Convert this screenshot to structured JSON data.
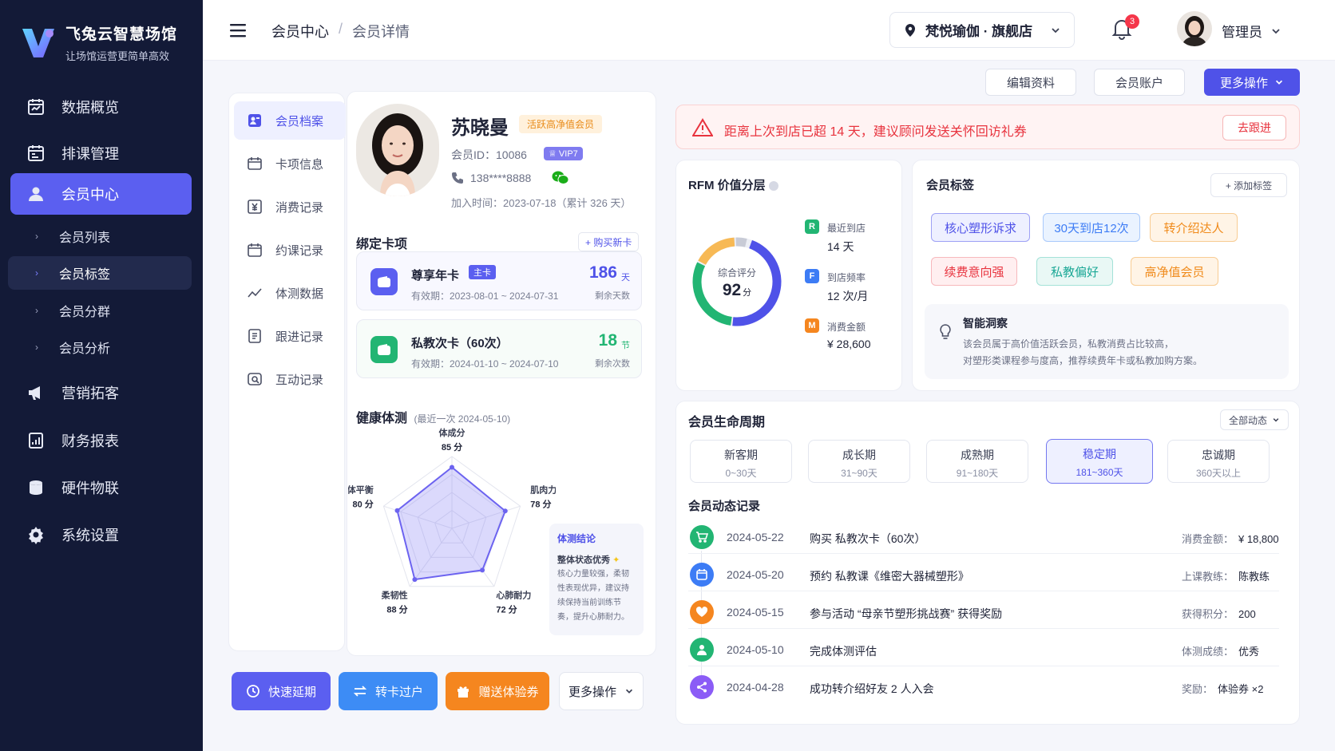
{
  "brand": {
    "name": "飞兔云智慧场馆",
    "slogan": "让场馆运营更简单高效"
  },
  "nav": [
    {
      "label": "数据概览",
      "icon": "dashboard-icon"
    },
    {
      "label": "排课管理",
      "icon": "calendar-icon"
    },
    {
      "label": "会员中心",
      "icon": "user-icon"
    },
    {
      "label": "营销拓客",
      "icon": "megaphone-icon"
    },
    {
      "label": "财务报表",
      "icon": "finance-icon"
    },
    {
      "label": "硬件物联",
      "icon": "hardware-icon"
    },
    {
      "label": "系统设置",
      "icon": "gear-icon"
    }
  ],
  "subnav": [
    {
      "label": "会员列表"
    },
    {
      "label": "会员标签"
    },
    {
      "label": "会员分群"
    },
    {
      "label": "会员分析"
    }
  ],
  "header": {
    "crumb1": "会员中心",
    "sep": "/",
    "crumb2": "会员详情",
    "store": "梵悦瑜伽 · 旗舰店",
    "bell_count": "3",
    "user": "管理员"
  },
  "toolbar": {
    "edit": "编辑资料",
    "account": "会员账户",
    "more": "更多操作"
  },
  "tabs": [
    {
      "label": "会员档案"
    },
    {
      "label": "卡项信息"
    },
    {
      "label": "消费记录"
    },
    {
      "label": "约课记录"
    },
    {
      "label": "体测数据"
    },
    {
      "label": "跟进记录"
    },
    {
      "label": "互动记录"
    }
  ],
  "member": {
    "name": "苏晓曼",
    "tag": "活跃高净值会员",
    "id": "会员ID：10086",
    "vip": "VIP7",
    "phone": "138****8888",
    "joined": "加入时间：2023-07-18（累计 326 天）"
  },
  "cards": {
    "title": "绑定卡项",
    "buy": "+ 购买新卡",
    "items": [
      {
        "name": "尊享年卡",
        "tag": "主卡",
        "valid": "有效期：2023-08-01 ~ 2024-07-31",
        "value": "186",
        "unit": "天",
        "label": "剩余天数",
        "color": "#4f52e8"
      },
      {
        "name": "私教次卡（60次）",
        "tag": "",
        "valid": "有效期：2024-01-10 ~ 2024-07-10",
        "value": "18",
        "unit": "节",
        "label": "剩余次数",
        "color": "#22b573"
      }
    ]
  },
  "health": {
    "title": "健康体测",
    "sub": "(最近一次 2024-05-10)",
    "radar": [
      {
        "name": "体成分",
        "score": "85",
        "unit": "分",
        "value": 85
      },
      {
        "name": "肌肉力量",
        "score": "78",
        "unit": "分",
        "value": 78
      },
      {
        "name": "心肺耐力",
        "score": "72",
        "unit": "分",
        "value": 72
      },
      {
        "name": "柔韧性",
        "score": "88",
        "unit": "分",
        "value": 88
      },
      {
        "name": "身体平衡",
        "score": "80",
        "unit": "分",
        "value": 80
      }
    ],
    "conclusion": {
      "title": "体测结论",
      "summary": "整体状态优秀",
      "body": "核心力量较强，柔韧性表现优异，建议持续保持当前训练节奏，提升心肺耐力。"
    }
  },
  "actions": {
    "extend": "快速延期",
    "transfer": "转卡过户",
    "gift": "赠送体验券",
    "more": "更多操作"
  },
  "alert": {
    "text": "距离上次到店已超 14 天，建议顾问发送关怀回访礼券",
    "action": "去跟进"
  },
  "rfm": {
    "title": "RFM 价值分层",
    "score_label": "综合评分",
    "score": "92",
    "score_unit": "分",
    "score_value": 92,
    "items": [
      {
        "key": "R",
        "label": "最近到店",
        "value": "14 天",
        "color": "#22b573"
      },
      {
        "key": "F",
        "label": "到店频率",
        "value": "12 次/月",
        "color": "#3d7cf5"
      },
      {
        "key": "M",
        "label": "消费金额",
        "value": "¥ 28,600",
        "color": "#f5861f"
      }
    ]
  },
  "tags": {
    "title": "会员标签",
    "add": "+ 添加标签",
    "items": [
      {
        "label": "核心塑形诉求",
        "bg": "#eef0ff",
        "fg": "#4f52e8",
        "bd": "#9ea1f5"
      },
      {
        "label": "30天到店12次",
        "bg": "#eaf3ff",
        "fg": "#3d7cf5",
        "bd": "#a9c9fb"
      },
      {
        "label": "转介绍达人",
        "bg": "#fff4e6",
        "fg": "#f08a1a",
        "bd": "#f8cc93"
      },
      {
        "label": "续费意向强",
        "bg": "#ffeff0",
        "fg": "#e8333e",
        "bd": "#f7b8bc"
      },
      {
        "label": "私教偏好",
        "bg": "#e9f8f5",
        "fg": "#1ba896",
        "bd": "#a4e2d8"
      },
      {
        "label": "高净值会员",
        "bg": "#fff4e6",
        "fg": "#f08a1a",
        "bd": "#f8cc93"
      }
    ],
    "insight": {
      "title": "智能洞察",
      "line1": "该会员属于高价值活跃会员，私教消费占比较高，",
      "line2": "对塑形类课程参与度高，推荐续费年卡或私教加购方案。"
    }
  },
  "life": {
    "title": "会员生命周期",
    "filter": "全部动态",
    "stages": [
      {
        "name": "新客期",
        "range": "0~30天"
      },
      {
        "name": "成长期",
        "range": "31~90天"
      },
      {
        "name": "成熟期",
        "range": "91~180天"
      },
      {
        "name": "稳定期",
        "range": "181~360天"
      },
      {
        "name": "忠诚期",
        "range": "360天以上"
      }
    ],
    "log_title": "会员动态记录",
    "logs": [
      {
        "date": "2024-05-22",
        "event": "购买 私教次卡（60次）",
        "meta_k": "消费金额：",
        "meta_v": "¥ 18,800",
        "color": "#22b573",
        "icon": "cart-icon"
      },
      {
        "date": "2024-05-20",
        "event": "预约 私教课《维密大器械塑形》",
        "meta_k": "上课教练：",
        "meta_v": "陈教练",
        "color": "#3d7cf5",
        "icon": "calendar-icon"
      },
      {
        "date": "2024-05-15",
        "event": "参与活动 “母亲节塑形挑战赛” 获得奖励",
        "meta_k": "获得积分：",
        "meta_v": "200",
        "color": "#f5861f",
        "icon": "heart-icon"
      },
      {
        "date": "2024-05-10",
        "event": "完成体测评估",
        "meta_k": "体测成绩：",
        "meta_v": "优秀",
        "color": "#22b573",
        "icon": "person-icon"
      },
      {
        "date": "2024-04-28",
        "event": "成功转介绍好友 2 人入会",
        "meta_k": "奖励：",
        "meta_v": "体验券 ×2",
        "color": "#8b5cf6",
        "icon": "share-icon"
      }
    ]
  }
}
